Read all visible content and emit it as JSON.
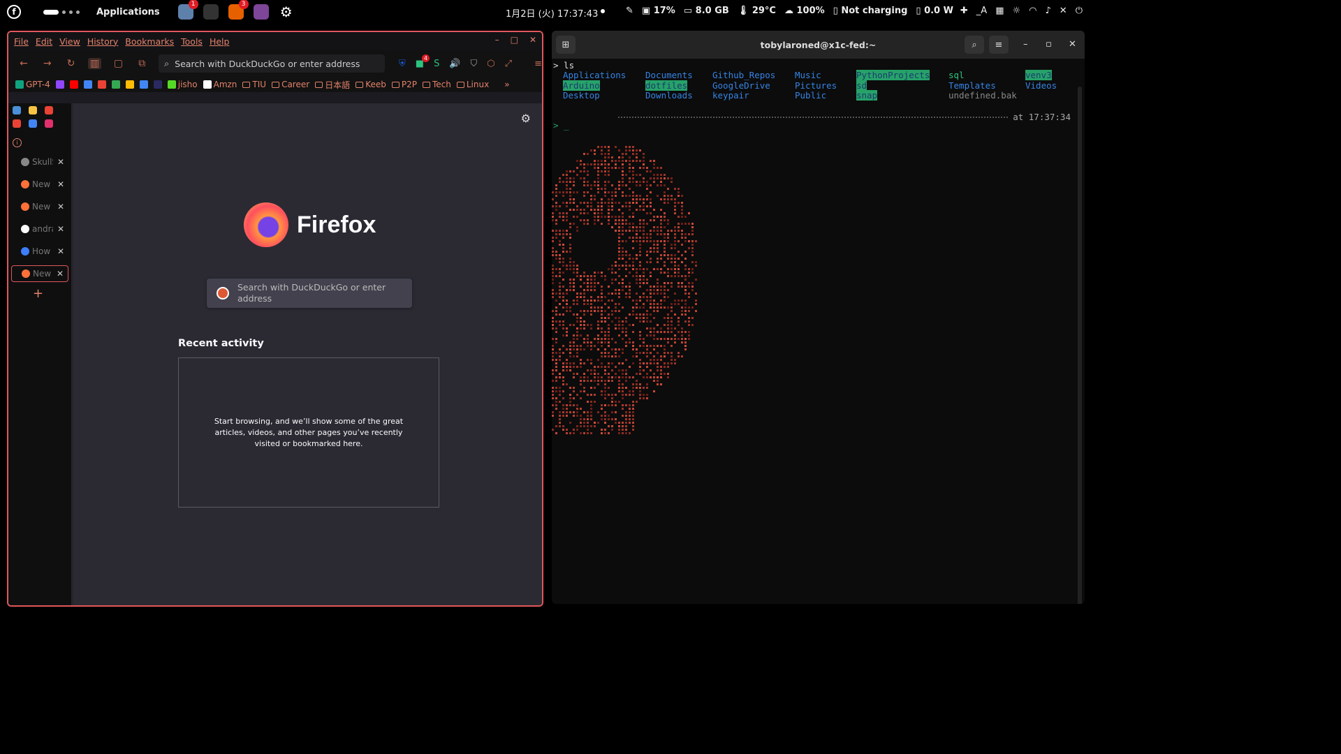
{
  "topbar": {
    "apps_label": "Applications",
    "dock": [
      {
        "name": "files",
        "badge": "1",
        "color": "#5e81ac"
      },
      {
        "name": "terminal",
        "badge": "",
        "color": "#333333"
      },
      {
        "name": "firefox",
        "badge": "3",
        "color": "#e66000"
      },
      {
        "name": "tor",
        "badge": "",
        "color": "#7d4698"
      },
      {
        "name": "settings",
        "badge": "",
        "color": "#000000"
      }
    ],
    "clock": "1月2日 (火) 17:37:43",
    "status": [
      "17%",
      "8.0 GB",
      "29°C",
      "100%",
      "Not charging",
      "0.0 W"
    ],
    "tray_lang": "_A"
  },
  "firefox": {
    "menu": [
      "File",
      "Edit",
      "View",
      "History",
      "Bookmarks",
      "Tools",
      "Help"
    ],
    "url_placeholder": "Search with DuckDuckGo or enter address",
    "ext_badge": "4",
    "bookmarks": [
      {
        "label": "GPT-4",
        "kind": "fav",
        "color": "#10a37f"
      },
      {
        "label": "",
        "kind": "fav",
        "color": "#9146ff"
      },
      {
        "label": "",
        "kind": "fav",
        "color": "#ff0000"
      },
      {
        "label": "",
        "kind": "fav",
        "color": "#4285f4"
      },
      {
        "label": "",
        "kind": "fav",
        "color": "#ea4335"
      },
      {
        "label": "",
        "kind": "fav",
        "color": "#34a853"
      },
      {
        "label": "",
        "kind": "fav",
        "color": "#fbbc05"
      },
      {
        "label": "",
        "kind": "fav",
        "color": "#4285f4"
      },
      {
        "label": "",
        "kind": "fav",
        "color": "#2a2a60"
      },
      {
        "label": "jisho",
        "kind": "fav",
        "color": "#56d926"
      },
      {
        "label": "Amzn",
        "kind": "fav",
        "color": "#ffffff"
      },
      {
        "label": "TIU",
        "kind": "folder"
      },
      {
        "label": "Career",
        "kind": "folder"
      },
      {
        "label": "日本語",
        "kind": "folder"
      },
      {
        "label": "Keeb",
        "kind": "folder"
      },
      {
        "label": "P2P",
        "kind": "folder"
      },
      {
        "label": "Tech",
        "kind": "folder"
      },
      {
        "label": "Linux",
        "kind": "folder"
      }
    ],
    "pinned": [
      "#4a90d9",
      "#f6c343",
      "#ea4335",
      "#ea4335",
      "#4285f4",
      "#e1306c"
    ],
    "tabs": [
      {
        "title": "SkullS",
        "color": "#888888",
        "selected": false
      },
      {
        "title": "New Tab",
        "color": "#ff7139",
        "selected": false
      },
      {
        "title": "New Tab",
        "color": "#ff7139",
        "selected": false
      },
      {
        "title": "andra",
        "color": "#ffffff",
        "selected": false
      },
      {
        "title": "How T",
        "color": "#3d7eff",
        "selected": false
      },
      {
        "title": "New Tab",
        "color": "#ff7139",
        "selected": true
      }
    ],
    "brand": "Firefox",
    "search_placeholder": "Search with DuckDuckGo or enter address",
    "recent_title": "Recent activity",
    "recent_message": "Start browsing, and we’ll show some of the great articles, videos, and other pages you’ve recently visited or bookmarked here."
  },
  "terminal": {
    "title": "tobylaroned@x1c-fed:~",
    "command": "> ls",
    "columns": [
      [
        "Applications",
        "Arduino",
        "Desktop"
      ],
      [
        "Documents",
        "dotfiles",
        "Downloads"
      ],
      [
        "Github_Repos",
        "GoogleDrive",
        "keypair"
      ],
      [
        "Music",
        "Pictures",
        "Public"
      ],
      [
        "PythonProjects",
        "sd",
        "snap"
      ],
      [
        "sql",
        "Templates",
        "undefined.bak"
      ],
      [
        "venv3",
        "Videos"
      ]
    ],
    "highlighted": [
      "Arduino",
      "dotfiles",
      "PythonProjects",
      "sd",
      "snap",
      "venv3"
    ],
    "timestamp": "at 17:37:34",
    "prompt_line": "> _"
  }
}
